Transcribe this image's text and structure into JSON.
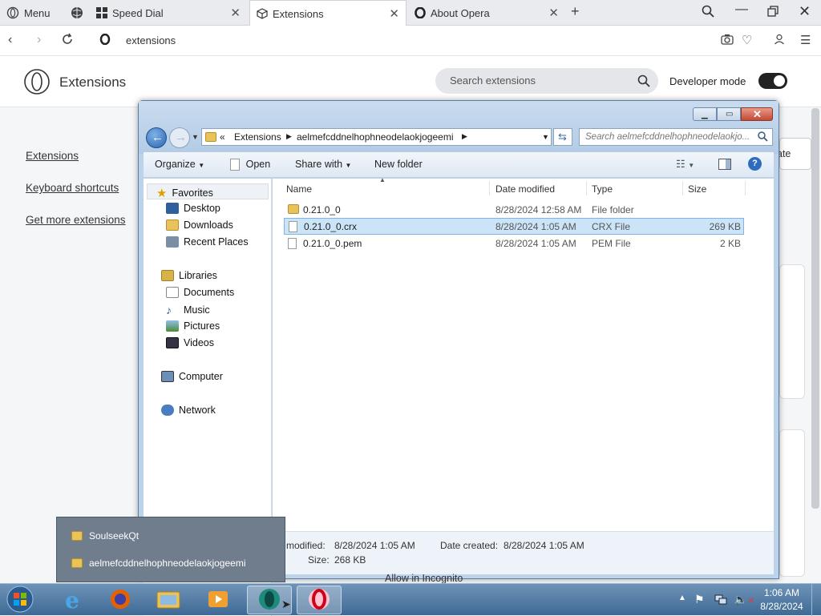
{
  "browser": {
    "menu_label": "Menu",
    "tabs": [
      {
        "label": "Speed Dial"
      },
      {
        "label": "Extensions"
      },
      {
        "label": "About Opera"
      }
    ],
    "address": "extensions"
  },
  "extensions_page": {
    "title": "Extensions",
    "search_placeholder": "Search extensions",
    "developer_mode_label": "Developer mode",
    "developer_mode_on": true,
    "sidebar": [
      {
        "label": "Extensions"
      },
      {
        "label": "Keyboard shortcuts"
      },
      {
        "label": "Get more extensions"
      }
    ],
    "partial_button_label": "ate",
    "partial_text": "Allow in Incognito"
  },
  "explorer": {
    "breadcrumb": [
      "«",
      "Extensions",
      "aelmefcddnelhophneodelaokjogeemi"
    ],
    "search_placeholder": "Search aelmefcddnelhophneodelaokjo...",
    "toolbar": {
      "organize": "Organize",
      "open": "Open",
      "share_with": "Share with",
      "new_folder": "New folder"
    },
    "nav": {
      "favorites": "Favorites",
      "favorite_items": [
        "Desktop",
        "Downloads",
        "Recent Places"
      ],
      "libraries": "Libraries",
      "library_items": [
        "Documents",
        "Music",
        "Pictures",
        "Videos"
      ],
      "computer": "Computer",
      "network": "Network"
    },
    "columns": {
      "name": "Name",
      "date": "Date modified",
      "type": "Type",
      "size": "Size"
    },
    "files": [
      {
        "name": "0.21.0_0",
        "date": "8/28/2024 12:58 AM",
        "type": "File folder",
        "size": ""
      },
      {
        "name": "0.21.0_0.crx",
        "date": "8/28/2024 1:05 AM",
        "type": "CRX File",
        "size": "269 KB"
      },
      {
        "name": "0.21.0_0.pem",
        "date": "8/28/2024 1:05 AM",
        "type": "PEM File",
        "size": "2 KB"
      }
    ],
    "selected_file_index": 1,
    "details": {
      "modified_label": "modified:",
      "modified_value": "8/28/2024 1:05 AM",
      "created_label": "Date created:",
      "created_value": "8/28/2024 1:05 AM",
      "size_label": "Size:",
      "size_value": "268 KB"
    }
  },
  "jump_list": {
    "items": [
      "SoulseekQt",
      "aelmefcddnelhophneodelaokjogeemi"
    ]
  },
  "taskbar": {
    "time": "1:06 AM",
    "date": "8/28/2024"
  },
  "colors": {
    "opera_red": "#d0021b",
    "selection": "#cce4f7",
    "taskbar": "#4a7199"
  }
}
